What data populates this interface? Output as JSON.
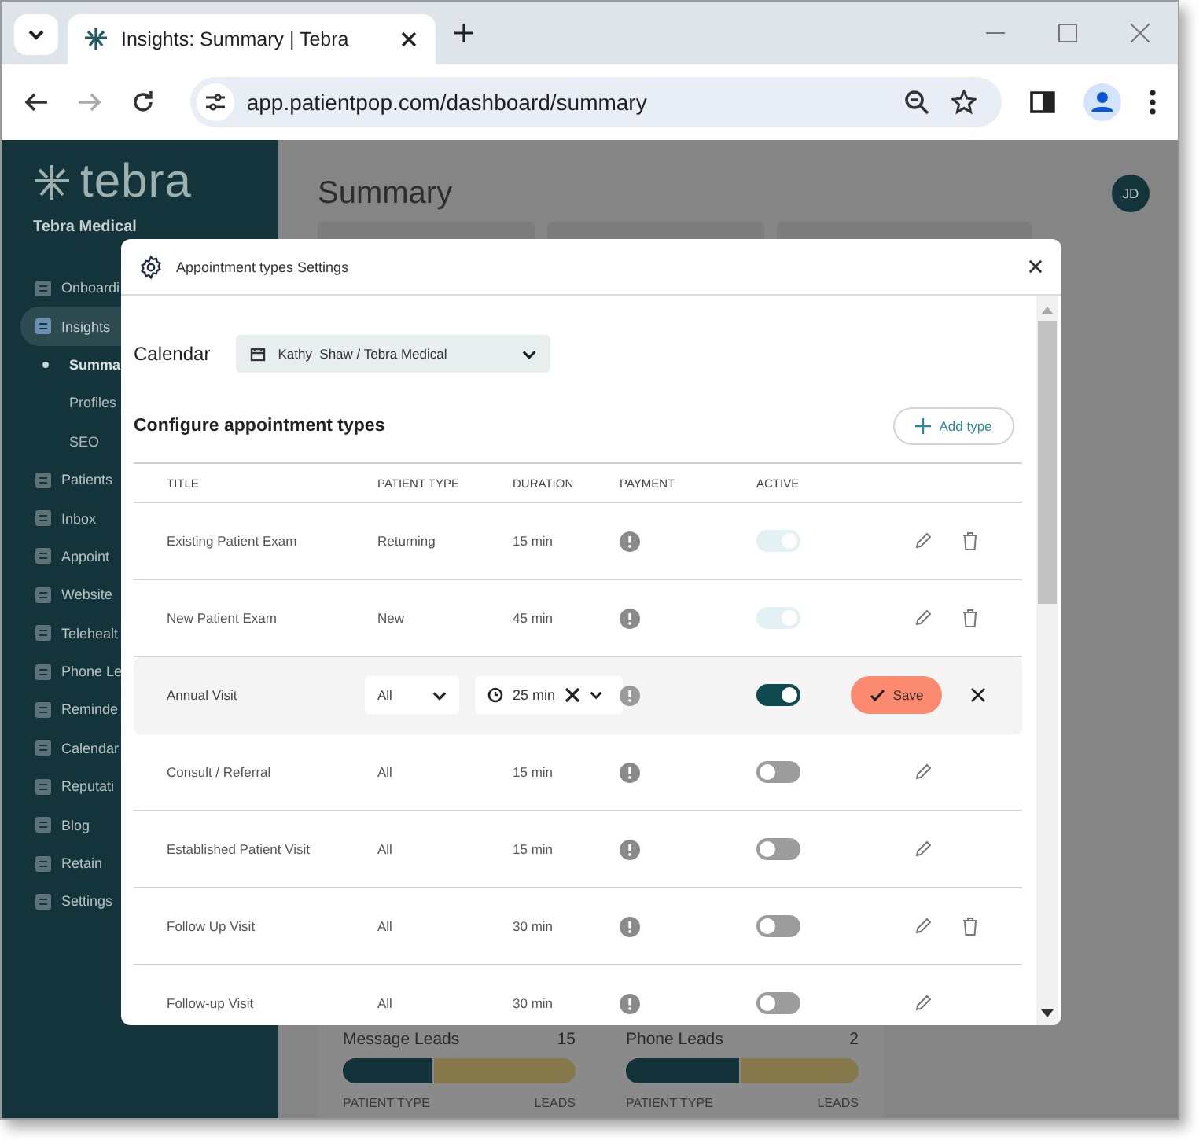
{
  "browser": {
    "tab_title": "Insights: Summary | Tebra",
    "url": "app.patientpop.com/dashboard/summary"
  },
  "sidebar": {
    "logo": "tebra",
    "practice": "Tebra Medical",
    "items": [
      {
        "label": "Onboardi",
        "selected": false
      },
      {
        "label": "Insights",
        "selected": true,
        "children": [
          {
            "label": "Summa",
            "selected": true
          },
          {
            "label": "Profiles",
            "selected": false
          },
          {
            "label": "SEO",
            "selected": false
          }
        ]
      },
      {
        "label": "Patients",
        "selected": false
      },
      {
        "label": "Inbox",
        "selected": false
      },
      {
        "label": "Appoint",
        "selected": false
      },
      {
        "label": "Website",
        "selected": false
      },
      {
        "label": "Telehealt",
        "selected": false
      },
      {
        "label": "Phone Le",
        "selected": false
      },
      {
        "label": "Reminde",
        "selected": false
      },
      {
        "label": "Calendar",
        "selected": false
      },
      {
        "label": "Reputati",
        "selected": false
      },
      {
        "label": "Blog",
        "selected": false
      },
      {
        "label": "Retain",
        "selected": false
      },
      {
        "label": "Settings",
        "selected": false
      }
    ]
  },
  "page": {
    "title": "Summary",
    "avatar": "JD",
    "cards": [
      {
        "label": "Message Leads",
        "count": "15",
        "level": 0.39,
        "column_1": "PATIENT TYPE",
        "column_2": "LEADS"
      },
      {
        "label": "Phone Leads",
        "count": "2",
        "level": 0.49,
        "column_1": "PATIENT TYPE",
        "column_2": "LEADS"
      }
    ]
  },
  "dialog": {
    "title": "Appointment types Settings",
    "calendar_label": "Calendar",
    "calendar_value": "Kathy  Shaw / Tebra Medical",
    "section_title": "Configure appointment types",
    "add_button": "Add type",
    "columns": [
      "TITLE",
      "PATIENT TYPE",
      "DURATION",
      "PAYMENT",
      "ACTIVE"
    ],
    "rows": [
      {
        "kind": "view",
        "title": "Existing Patient Exam",
        "patient_type": "Returning",
        "duration": "15 min",
        "active": true,
        "disabled": true,
        "deletable": true
      },
      {
        "kind": "view",
        "title": "New Patient Exam",
        "patient_type": "New",
        "duration": "45 min",
        "active": true,
        "disabled": true,
        "deletable": true
      },
      {
        "kind": "edit",
        "title": "Annual Visit",
        "patient_type": "All",
        "duration": "25 min",
        "active": true,
        "disabled": false,
        "save": "Save"
      },
      {
        "kind": "view",
        "title": "Consult / Referral",
        "patient_type": "All",
        "duration": "15 min",
        "active": false,
        "disabled": false,
        "deletable": false
      },
      {
        "kind": "view",
        "title": "Established Patient Visit",
        "patient_type": "All",
        "duration": "15 min",
        "active": false,
        "disabled": false,
        "deletable": false
      },
      {
        "kind": "view",
        "title": "Follow Up Visit",
        "patient_type": "All",
        "duration": "30 min",
        "active": false,
        "disabled": false,
        "deletable": true
      },
      {
        "kind": "view",
        "title": "Follow-up Visit",
        "patient_type": "All",
        "duration": "30 min",
        "active": false,
        "disabled": false,
        "deletable": false
      }
    ]
  }
}
